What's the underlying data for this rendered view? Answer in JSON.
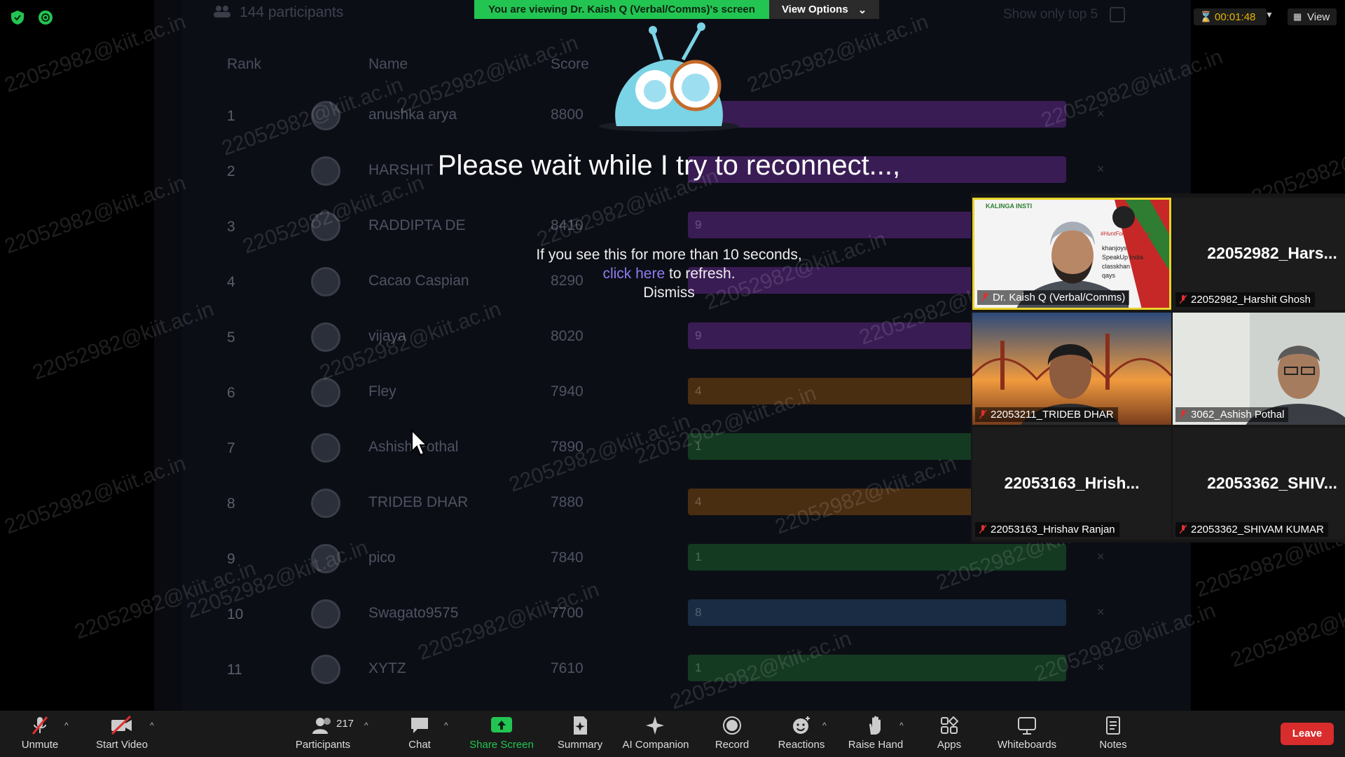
{
  "share": {
    "participants_count": "144 participants",
    "top5_label": "Show only top 5",
    "headers": {
      "rank": "Rank",
      "name": "Name",
      "score": "Score"
    },
    "rows": [
      {
        "rank": "1",
        "name": "anushka arya",
        "score": "8800",
        "bar": "",
        "color": "#3a1c55"
      },
      {
        "rank": "2",
        "name": "HARSHIT",
        "score": "",
        "bar": "",
        "color": "#3a1c55"
      },
      {
        "rank": "3",
        "name": "RADDIPTA DE",
        "score": "8410",
        "bar": "9",
        "color": "#3a1c55"
      },
      {
        "rank": "4",
        "name": "Cacao Caspian",
        "score": "8290",
        "bar": "",
        "color": "#3a1c55"
      },
      {
        "rank": "5",
        "name": "vijaya",
        "score": "8020",
        "bar": "9",
        "color": "#3a1c55"
      },
      {
        "rank": "6",
        "name": "Fley",
        "score": "7940",
        "bar": "4",
        "color": "#4a2e12"
      },
      {
        "rank": "7",
        "name": "Ashish Pothal",
        "score": "7890",
        "bar": "1",
        "color": "#143a22"
      },
      {
        "rank": "8",
        "name": "TRIDEB DHAR",
        "score": "7880",
        "bar": "4",
        "color": "#4a2e12"
      },
      {
        "rank": "9",
        "name": "pico",
        "score": "7840",
        "bar": "1",
        "color": "#143a22"
      },
      {
        "rank": "10",
        "name": "Swagato9575",
        "score": "7700",
        "bar": "8",
        "color": "#1a2c44"
      },
      {
        "rank": "11",
        "name": "XYTZ",
        "score": "7610",
        "bar": "1",
        "color": "#143a22"
      }
    ],
    "watermark": "22052982@kiit.ac.in"
  },
  "overlay": {
    "title": "Please wait while I try to reconnect...,",
    "line1": "If you see this for more than 10 seconds,",
    "link": "click here",
    "line2_rest": " to refresh.",
    "dismiss": "Dismiss"
  },
  "banner": {
    "viewing": "You are viewing Dr. Kaish Q (Verbal/Comms)'s screen",
    "view_options": "View Options"
  },
  "top_right": {
    "timer": "00:01:48",
    "view": "View"
  },
  "gallery": [
    {
      "label": "Dr. Kaish Q (Verbal/Comms)",
      "big": "",
      "kind": "host"
    },
    {
      "label": "22052982_Harshit Ghosh",
      "big": "22052982_Hars...",
      "kind": "name"
    },
    {
      "label": "22053211_TRIDEB DHAR",
      "big": "",
      "kind": "video1"
    },
    {
      "label": "3062_Ashish Pothal",
      "big": "",
      "kind": "video2"
    },
    {
      "label": "22053163_Hrishav Ranjan",
      "big": "22053163_Hrish...",
      "kind": "name"
    },
    {
      "label": "22053362_SHIVAM KUMAR",
      "big": "22053362_SHIV...",
      "kind": "name"
    }
  ],
  "host_slide_text": [
    "KALINGA INSTI",
    "#HuntForHappiness",
    "khanjoys",
    "SpeakUp India",
    "classkhan",
    "qays"
  ],
  "toolbar": {
    "unmute": "Unmute",
    "start_video": "Start Video",
    "participants": "Participants",
    "participants_count": "217",
    "chat": "Chat",
    "share_screen": "Share Screen",
    "summary": "Summary",
    "ai_companion": "AI Companion",
    "record": "Record",
    "reactions": "Reactions",
    "raise_hand": "Raise Hand",
    "apps": "Apps",
    "whiteboards": "Whiteboards",
    "notes": "Notes",
    "leave": "Leave"
  }
}
